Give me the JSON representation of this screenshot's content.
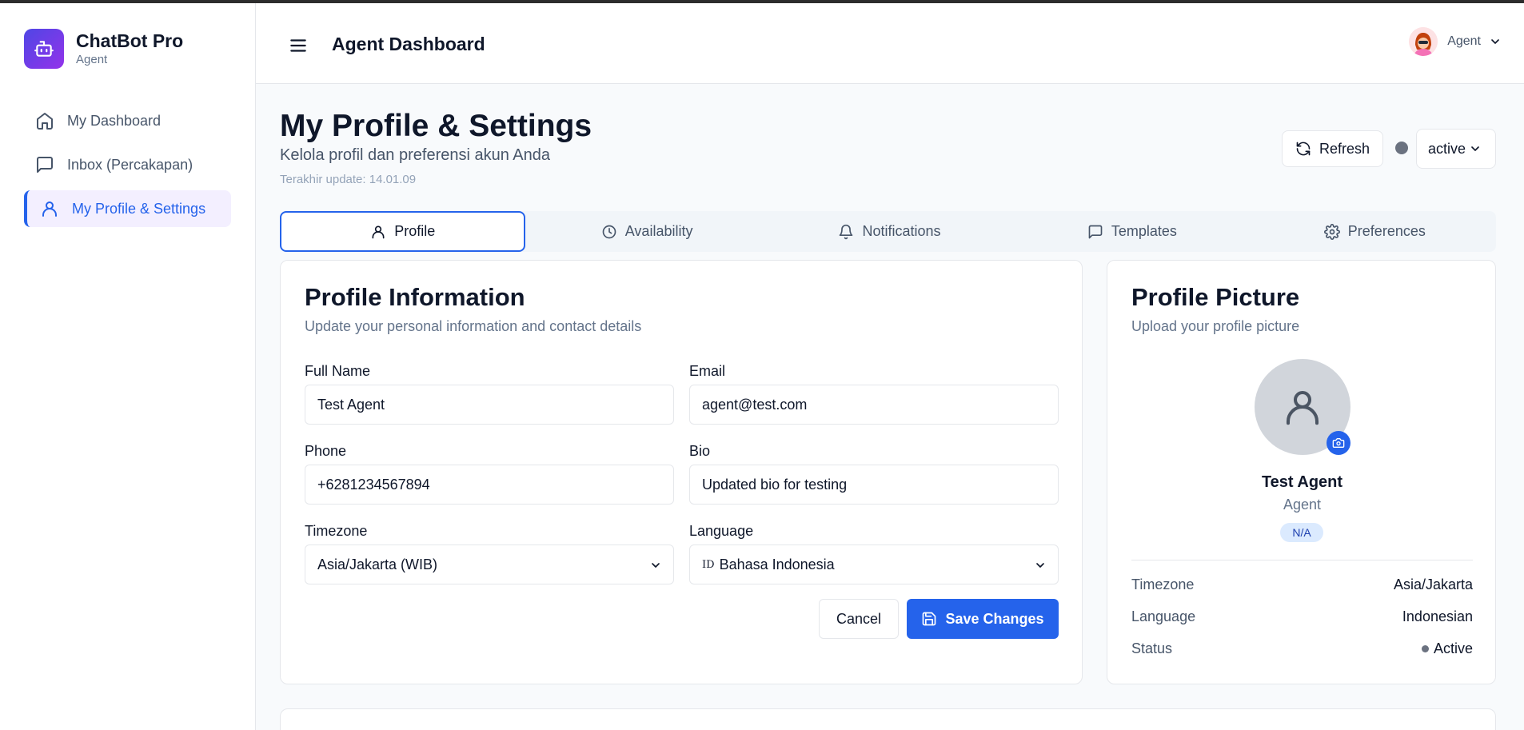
{
  "brand": {
    "title": "ChatBot Pro",
    "subtitle": "Agent"
  },
  "sidebar": {
    "items": [
      {
        "label": "My Dashboard",
        "icon": "home-icon"
      },
      {
        "label": "Inbox (Percakapan)",
        "icon": "message-square-icon"
      },
      {
        "label": "My Profile & Settings",
        "icon": "user-icon",
        "active": true
      }
    ]
  },
  "header": {
    "title": "Agent Dashboard",
    "user_label": "Agent"
  },
  "page": {
    "title": "My Profile & Settings",
    "subtitle": "Kelola profil dan preferensi akun Anda",
    "updated": "Terakhir update: 14.01.09",
    "refresh_label": "Refresh",
    "status_value": "active"
  },
  "tabs": [
    {
      "label": "Profile",
      "icon": "user-icon",
      "active": true
    },
    {
      "label": "Availability",
      "icon": "clock-icon"
    },
    {
      "label": "Notifications",
      "icon": "bell-icon"
    },
    {
      "label": "Templates",
      "icon": "message-square-icon"
    },
    {
      "label": "Preferences",
      "icon": "gear-icon"
    }
  ],
  "profile_form": {
    "title": "Profile Information",
    "description": "Update your personal information and contact details",
    "full_name": {
      "label": "Full Name",
      "value": "Test Agent"
    },
    "email": {
      "label": "Email",
      "value": "agent@test.com"
    },
    "phone": {
      "label": "Phone",
      "value": "+6281234567894"
    },
    "bio": {
      "label": "Bio",
      "value": "Updated bio for testing"
    },
    "timezone": {
      "label": "Timezone",
      "value": "Asia/Jakarta (WIB)"
    },
    "language": {
      "label": "Language",
      "flag": "ID",
      "value": "Bahasa Indonesia"
    },
    "cancel_label": "Cancel",
    "save_label": "Save Changes"
  },
  "profile_picture": {
    "title": "Profile Picture",
    "description": "Upload your profile picture",
    "name": "Test Agent",
    "role": "Agent",
    "badge": "N/A",
    "info": [
      {
        "key": "Timezone",
        "value": "Asia/Jakarta"
      },
      {
        "key": "Language",
        "value": "Indonesian"
      },
      {
        "key": "Status",
        "value": "Active"
      }
    ]
  },
  "colors": {
    "accent": "#2563eb",
    "brand_gradient_start": "#4f46e5",
    "brand_gradient_end": "#9333ea",
    "status_dot": "#6b7280"
  }
}
